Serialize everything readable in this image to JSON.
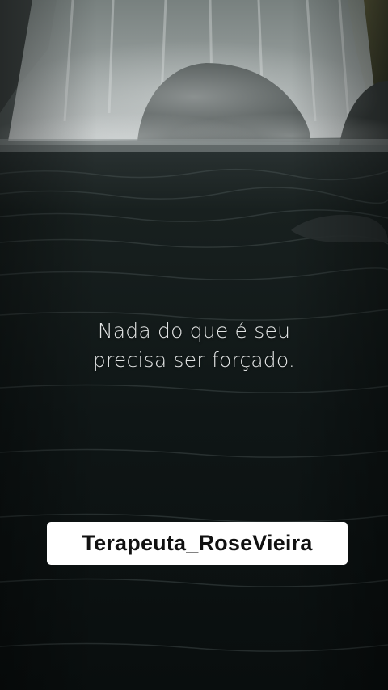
{
  "quote": {
    "line1": "Nada do que é seu",
    "line2": "precisa ser forçado."
  },
  "watermark": {
    "handle": "Terapeuta_RoseVieira"
  },
  "colors": {
    "water": "#0c1212",
    "falls": "#bcc2c2",
    "quote_text": "#e2e4e4",
    "watermark_bg": "#ffffff",
    "watermark_text": "#111111"
  }
}
